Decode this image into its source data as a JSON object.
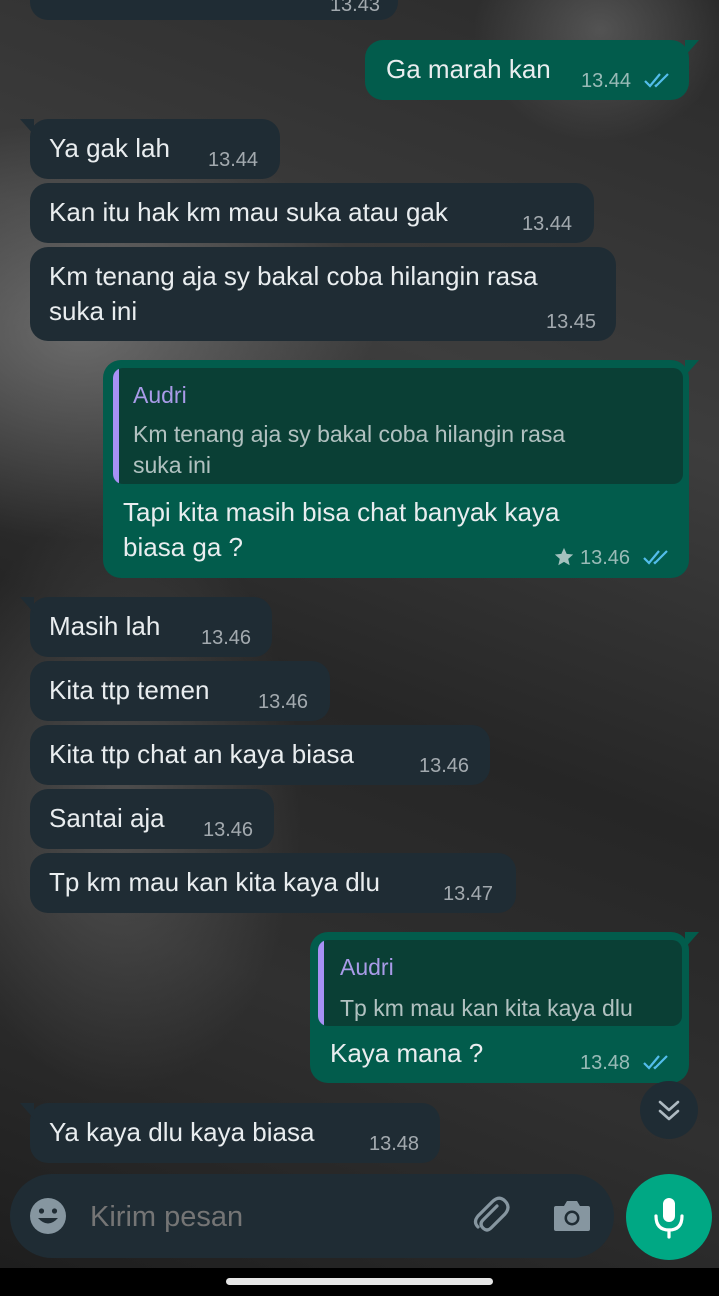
{
  "messages": [
    {
      "dir": "in",
      "text": "",
      "time": "13.43"
    },
    {
      "dir": "out",
      "text": "Ga marah kan",
      "time": "13.44",
      "status": "read"
    },
    {
      "dir": "in",
      "text": "Ya gak lah",
      "time": "13.44"
    },
    {
      "dir": "in",
      "text": "Kan itu hak km mau suka atau gak",
      "time": "13.44"
    },
    {
      "dir": "in",
      "text": "Km tenang aja sy bakal coba hilangin rasa\nsuka ini",
      "time": "13.45"
    },
    {
      "dir": "out",
      "quote": {
        "author": "Audri",
        "text": "Km tenang aja sy bakal coba hilangin rasa\nsuka ini"
      },
      "text": "Tapi kita masih bisa chat banyak kaya\nbiasa ga ?",
      "time": "13.46",
      "starred": true,
      "status": "read"
    },
    {
      "dir": "in",
      "text": "Masih lah",
      "time": "13.46"
    },
    {
      "dir": "in",
      "text": "Kita ttp temen",
      "time": "13.46"
    },
    {
      "dir": "in",
      "text": "Kita ttp chat an kaya biasa",
      "time": "13.46"
    },
    {
      "dir": "in",
      "text": "Santai aja",
      "time": "13.46"
    },
    {
      "dir": "in",
      "text": "Tp km mau kan kita kaya dlu",
      "time": "13.47"
    },
    {
      "dir": "out",
      "quote": {
        "author": "Audri",
        "text": "Tp km mau kan kita kaya dlu"
      },
      "text": "Kaya mana ?",
      "time": "13.48",
      "status": "read"
    },
    {
      "dir": "in",
      "text": "Ya kaya dlu kaya biasa",
      "time": "13.48"
    }
  ],
  "composer": {
    "placeholder": "Kirim pesan",
    "emoji_icon": "emoji-icon",
    "attach_icon": "paperclip-icon",
    "camera_icon": "camera-icon",
    "mic_icon": "microphone-icon"
  },
  "scroll_button_icon": "double-chevron-down-icon",
  "colors": {
    "incoming_bubble": "#1f2c34",
    "outgoing_bubble": "#025c4c",
    "accent": "#00a884",
    "read_ticks": "#53bdeb",
    "quote_author": "#a99be8"
  }
}
